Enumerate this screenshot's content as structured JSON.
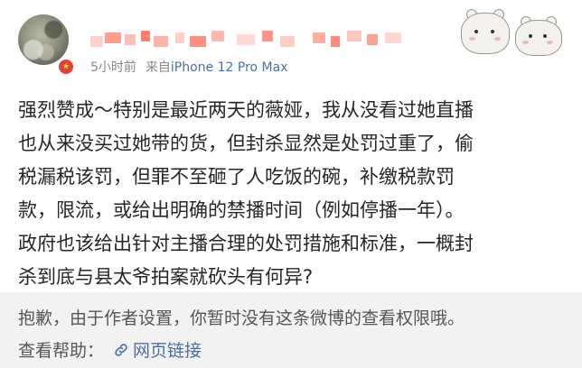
{
  "post": {
    "meta": {
      "time": "5小时前",
      "source_prefix": "来自",
      "device": "iPhone 12 Pro Max"
    },
    "body_lines": [
      "强烈赞成～特别是最近两天的薇娅，我从没看过她直播",
      "也从来没买过她带的货，但封杀显然是处罚过重了，偷",
      "税漏税该罚，但罪不至砸了人吃饭的碗，补缴税款罚",
      "款，限流，或给出明确的禁播时间（例如停播一年）。",
      "政府也该给出针对主播合理的处罚措施和标准，一概封",
      "杀到底与县太爷拍案就砍头有何异?"
    ]
  },
  "notice": {
    "text": "抱歉，由于作者设置，你暂时没有这条微博的查看权限哦。",
    "help_label": "查看帮助：",
    "link_label": "网页链接"
  },
  "icons": {
    "avatar_badge": "verified-badge-icon",
    "link": "link-icon",
    "sticker": "cartoon-sticker-icon"
  },
  "colors": {
    "link": "#4a6fa5",
    "meta": "#888888",
    "badge": "#e0413a",
    "notice_bg": "#f2f2f2"
  }
}
